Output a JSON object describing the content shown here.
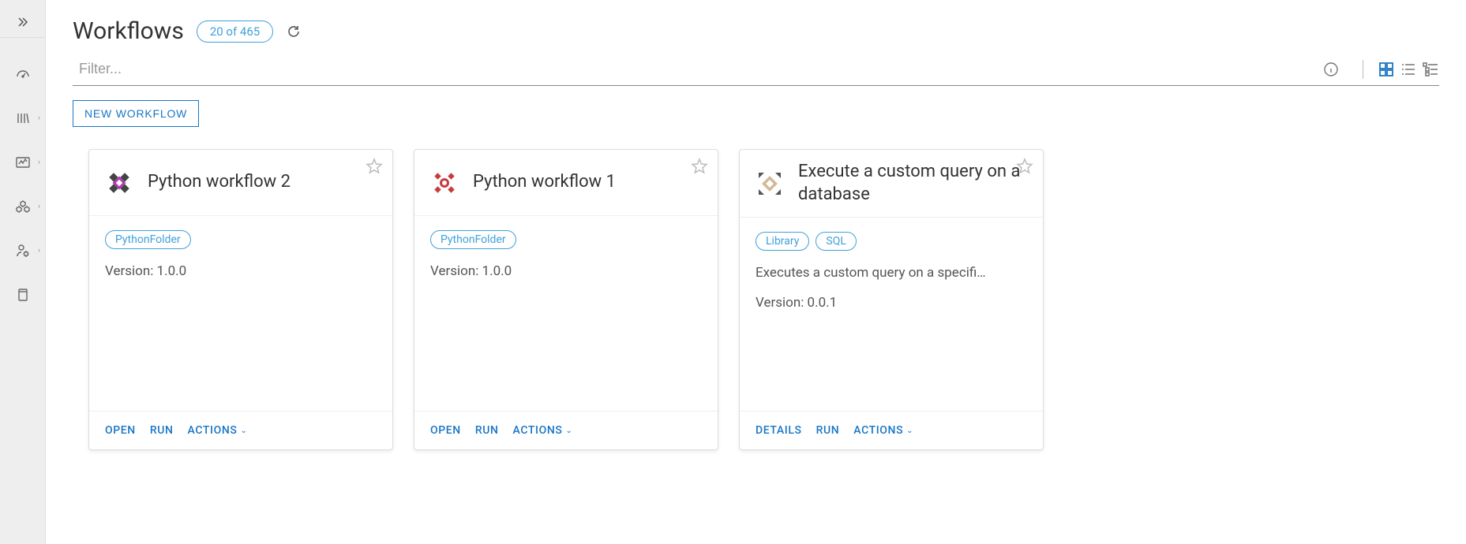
{
  "header": {
    "title": "Workflows",
    "count_label": "20 of 465"
  },
  "filter": {
    "placeholder": "Filter..."
  },
  "buttons": {
    "new_workflow": "NEW WORKFLOW"
  },
  "cards": [
    {
      "title": "Python workflow 2",
      "tags": [
        "PythonFolder"
      ],
      "description": "",
      "version": "Version: 1.0.0",
      "actions": [
        "OPEN",
        "RUN",
        "ACTIONS"
      ],
      "icon_color": "#b23cb2",
      "icon_accent": "#444"
    },
    {
      "title": "Python workflow 1",
      "tags": [
        "PythonFolder"
      ],
      "description": "",
      "version": "Version: 1.0.0",
      "actions": [
        "OPEN",
        "RUN",
        "ACTIONS"
      ],
      "icon_color": "#c63c3c",
      "icon_accent": "#c63c3c"
    },
    {
      "title": "Execute a custom query on a database",
      "tags": [
        "Library",
        "SQL"
      ],
      "description": "Executes a custom query on a specifi…",
      "version": "Version: 0.0.1",
      "actions": [
        "DETAILS",
        "RUN",
        "ACTIONS"
      ],
      "icon_color": "#d4b896",
      "icon_accent": "#555"
    }
  ]
}
